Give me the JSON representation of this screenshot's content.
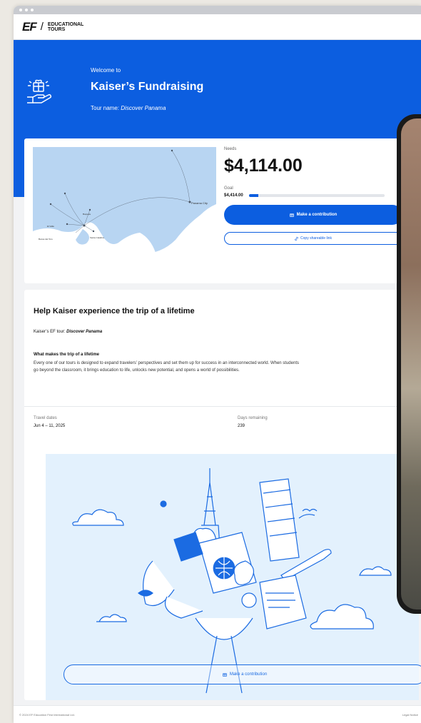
{
  "brand": {
    "logo_mark": "EF",
    "logo_slash": "/",
    "logo_line1": "EDUCATIONAL",
    "logo_line2": "TOURS"
  },
  "hero": {
    "welcome": "Welcome to",
    "title": "Kaiser’s Fundraising",
    "tour_prefix": "Tour name:",
    "tour_name": "Discover Panama",
    "icon": "gift-hand-icon"
  },
  "fundraising": {
    "needs_label": "Needs",
    "needs_amount": "$4,114.00",
    "goal_label": "Goal",
    "goal_amount": "$4,414.00",
    "progress_percent": 7,
    "contribute_label": "Make a contribution",
    "copy_link_label": "Copy shareable link"
  },
  "map": {
    "destination_label": "Panama City",
    "origin_labels": [
      "Bocas del Toro",
      "Santa Catalina",
      "El Valle",
      "Boquete"
    ]
  },
  "details": {
    "heading": "Help Kaiser experience the trip of a lifetime",
    "tour_prefix": "Kaiser’s EF tour:",
    "tour_name": "Discover Panama",
    "what_heading": "What makes the trip of a lifetime",
    "description": "Every one of our tours is designed to expand travelers’ perspectives and set them up for success in an interconnected world. When students go beyond the classroom, it brings education to life, unlocks new potential, and opens a world of possibilities.",
    "travel_dates_label": "Travel dates",
    "travel_dates": "Jun 4 – 11, 2025",
    "days_remaining_label": "Days remaining",
    "days_remaining": "239",
    "bottom_button_label": "Make a contribution"
  },
  "footer": {
    "copyright": "© 2024 EF Education First International Ltd.",
    "legal": "Legal Notice"
  },
  "colors": {
    "brand_blue": "#0c5ee0",
    "illustration_bg": "#e3f1fd"
  }
}
